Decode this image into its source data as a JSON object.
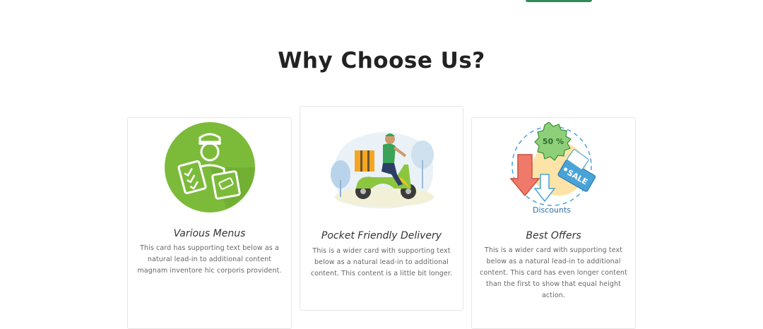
{
  "header": {
    "button_label": ""
  },
  "section": {
    "title": "Why Choose Us?"
  },
  "cards": [
    {
      "title": "Various Menus",
      "text": "This card has supporting text below as a natural lead-in to additional content magnam inventore hic corporis provident.",
      "image": "delivery-man-icon"
    },
    {
      "title": "Pocket Friendly Delivery",
      "text": "This is a wider card with supporting text below as a natural lead-in to additional content. This content is a little bit longer.",
      "image": "scooter-delivery-illustration"
    },
    {
      "title": "Best Offers",
      "text": "This is a wider card with supporting text below as a natural lead-in to additional content. This card has even longer content than the first to show that equal height action.",
      "image": "discounts-illustration",
      "badge": "50 %",
      "tag": "SALE",
      "caption": "Discounts"
    }
  ],
  "colors": {
    "accent_green": "#2e8b57",
    "icon_green": "#7cbb3a",
    "sale_blue": "#4aa3d8",
    "badge_green": "#8ed07a",
    "arrow_red": "#f07a6a",
    "sun_yellow": "#fde3a7"
  }
}
